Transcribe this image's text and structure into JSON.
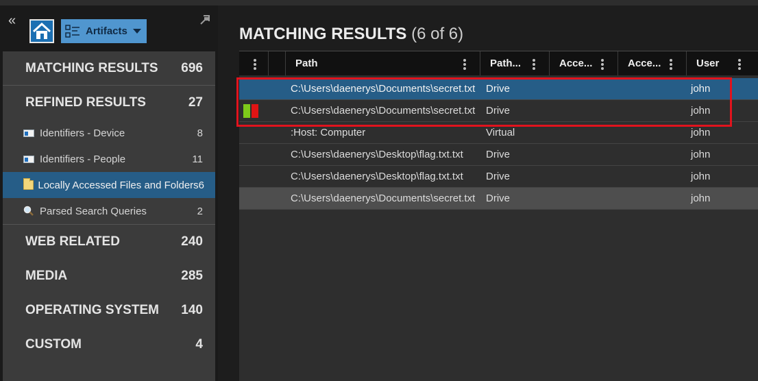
{
  "sidebar": {
    "collapse_glyph": "«",
    "artifacts_label": "Artifacts",
    "categories_top": [
      {
        "label": "MATCHING RESULTS",
        "count": "696"
      },
      {
        "label": "REFINED RESULTS",
        "count": "27"
      }
    ],
    "refined_items": [
      {
        "label": "Identifiers - Device",
        "count": "8",
        "icon": "id-card-icon"
      },
      {
        "label": "Identifiers - People",
        "count": "11",
        "icon": "id-card-icon"
      },
      {
        "label": "Locally Accessed Files and Folders",
        "count": "6",
        "icon": "folder-icon",
        "selected": true
      },
      {
        "label": "Parsed Search Queries",
        "count": "2",
        "icon": "magnifier-icon"
      }
    ],
    "categories_bottom": [
      {
        "label": "WEB RELATED",
        "count": "240"
      },
      {
        "label": "MEDIA",
        "count": "285"
      },
      {
        "label": "OPERATING SYSTEM",
        "count": "140"
      },
      {
        "label": "CUSTOM",
        "count": "4"
      }
    ]
  },
  "main": {
    "title": "MATCHING RESULTS",
    "count": "(6 of 6)",
    "columns": [
      "Path",
      "Path...",
      "Acce...",
      "Acce...",
      "User"
    ],
    "rows": [
      {
        "path": "C:\\Users\\daenerys\\Documents\\secret.txt",
        "type": "Drive",
        "user": "john",
        "state": "selected"
      },
      {
        "path": "C:\\Users\\daenerys\\Documents\\secret.txt",
        "type": "Drive",
        "user": "john",
        "flags": [
          "#7ec91a",
          "#e01414"
        ]
      },
      {
        "path": ":Host: Computer",
        "type": "Virtual",
        "user": "john"
      },
      {
        "path": "C:\\Users\\daenerys\\Desktop\\flag.txt.txt",
        "type": "Drive",
        "user": "john"
      },
      {
        "path": "C:\\Users\\daenerys\\Desktop\\flag.txt.txt",
        "type": "Drive",
        "user": "john"
      },
      {
        "path": "C:\\Users\\daenerys\\Documents\\secret.txt",
        "type": "Drive",
        "user": "john",
        "state": "hover"
      }
    ]
  },
  "colors": {
    "accent_blue": "#265d87",
    "annotation_red": "#e1131d"
  }
}
